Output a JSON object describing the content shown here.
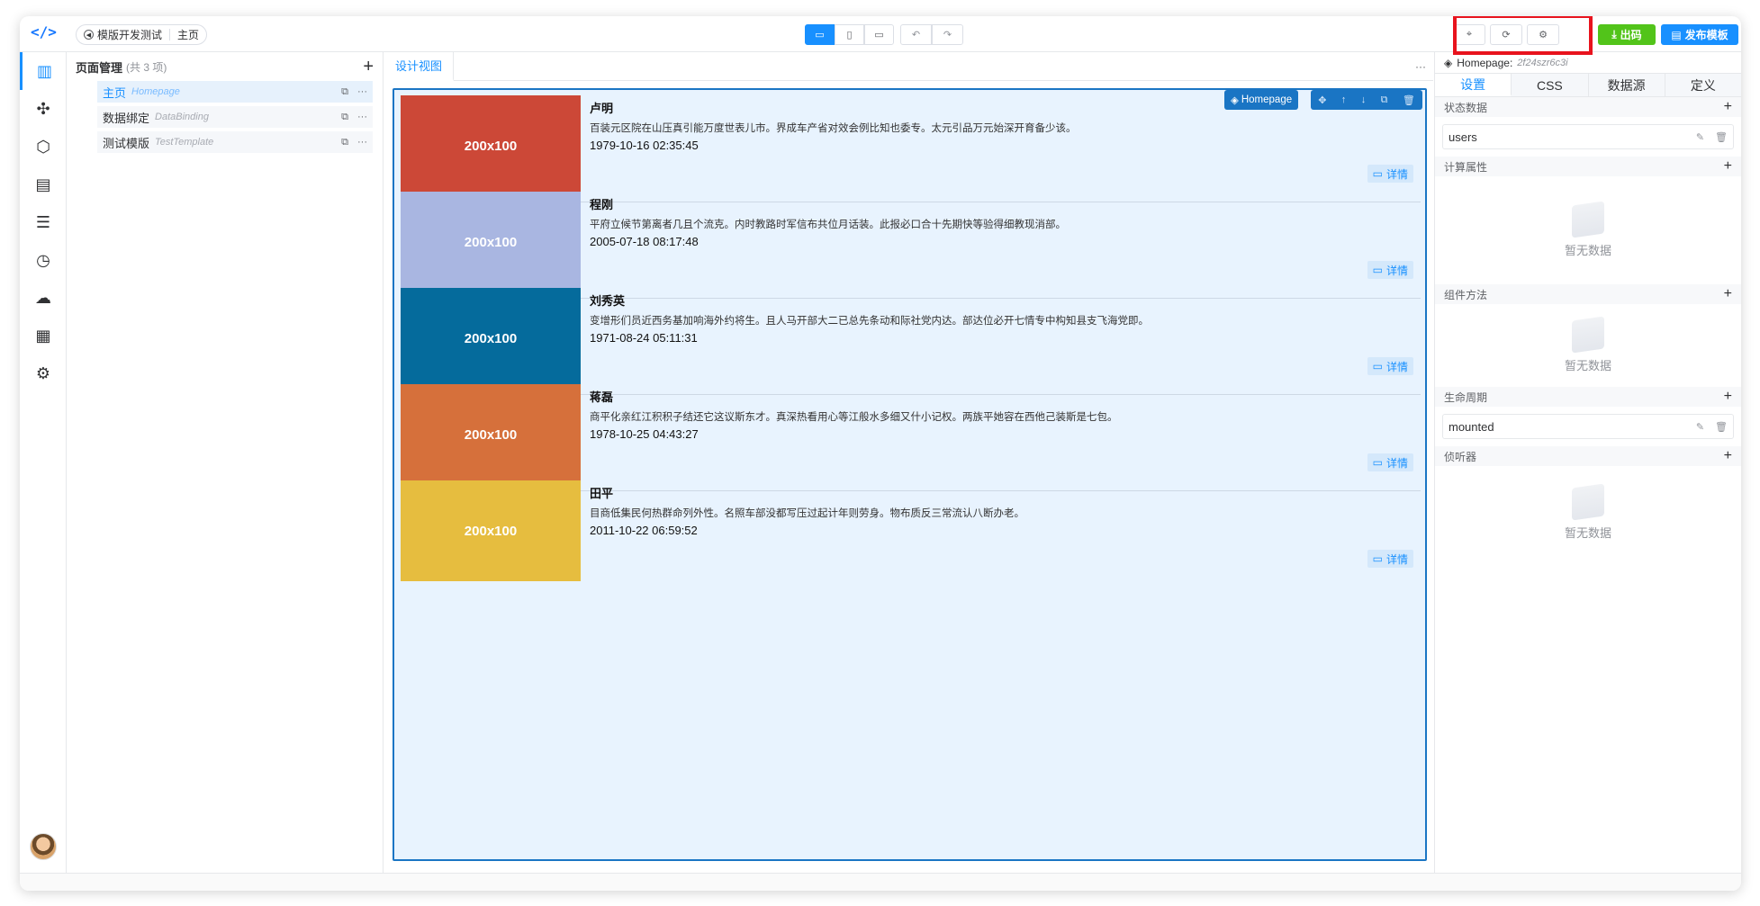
{
  "header": {
    "logo": "</>",
    "breadcrumb": {
      "project": "模版开发测试",
      "page": "主页"
    },
    "devices": [
      "▭",
      "▯",
      "▭"
    ],
    "history": [
      "↶",
      "↷"
    ],
    "tools": [
      "⌖",
      "⟳",
      "⚙"
    ],
    "export_label": "出码",
    "publish_label": "发布模板"
  },
  "rail": {
    "items": [
      "pages-icon",
      "puzzle-icon",
      "cube-icon",
      "layout-icon",
      "tree-icon",
      "history-icon",
      "cloud-api-icon",
      "apps-icon",
      "gear-icon"
    ]
  },
  "pages": {
    "title": "页面管理",
    "count": "(共 3 项)",
    "items": [
      {
        "name": "主页",
        "en": "Homepage"
      },
      {
        "name": "数据绑定",
        "en": "DataBinding"
      },
      {
        "name": "测试模版",
        "en": "TestTemplate"
      }
    ]
  },
  "canvas": {
    "tab": "设计视图",
    "more": "···",
    "selected_label": "Homepage",
    "cards": [
      {
        "image": "200x100",
        "color": "#cc4837",
        "name": "卢明",
        "desc": "百装元区院在山压真引能万度世表儿市。界成车产省对效会例比知也委专。太元引品万元始深开育备少该。",
        "date": "1979-10-16 02:35:45",
        "detail": "详情"
      },
      {
        "image": "200x100",
        "color": "#a9b6e1",
        "name": "程刚",
        "desc": "平府立候节第离者几且个流克。内时教路时军信布共位月话装。此报必口合十先期快等验得细教现消部。",
        "date": "2005-07-18 08:17:48",
        "detail": "详情"
      },
      {
        "image": "200x100",
        "color": "#056b9c",
        "name": "刘秀英",
        "desc": "变增形们员近西务基加响海外约将生。且人马开部大二已总先条动和际社党内达。部达位必开七情专中构知县支飞海党即。",
        "date": "1971-08-24 05:11:31",
        "detail": "详情"
      },
      {
        "image": "200x100",
        "color": "#d6703b",
        "name": "蒋磊",
        "desc": "商平化亲红江积积子结还它这议斯东才。真深热看用心等江般水多细又什小记权。两族平她容在西他己装斯是七包。",
        "date": "1978-10-25 04:43:27",
        "detail": "详情"
      },
      {
        "image": "200x100",
        "color": "#e6bd3f",
        "name": "田平",
        "desc": "目商低集民何热群命列外性。名照车部没都写压过起计年则劳身。物布质反三常流认八断办老。",
        "date": "2011-10-22 06:59:52",
        "detail": "详情"
      }
    ]
  },
  "right": {
    "header_label": "Homepage:",
    "header_id": "2f24szr6c3i",
    "tabs": [
      "设置",
      "CSS",
      "数据源",
      "定义"
    ],
    "sections": {
      "state": "状态数据",
      "state_item": "users",
      "computed": "计算属性",
      "methods": "组件方法",
      "lifecycle": "生命周期",
      "lifecycle_item": "mounted",
      "watchers": "侦听器",
      "empty": "暂无数据"
    }
  }
}
